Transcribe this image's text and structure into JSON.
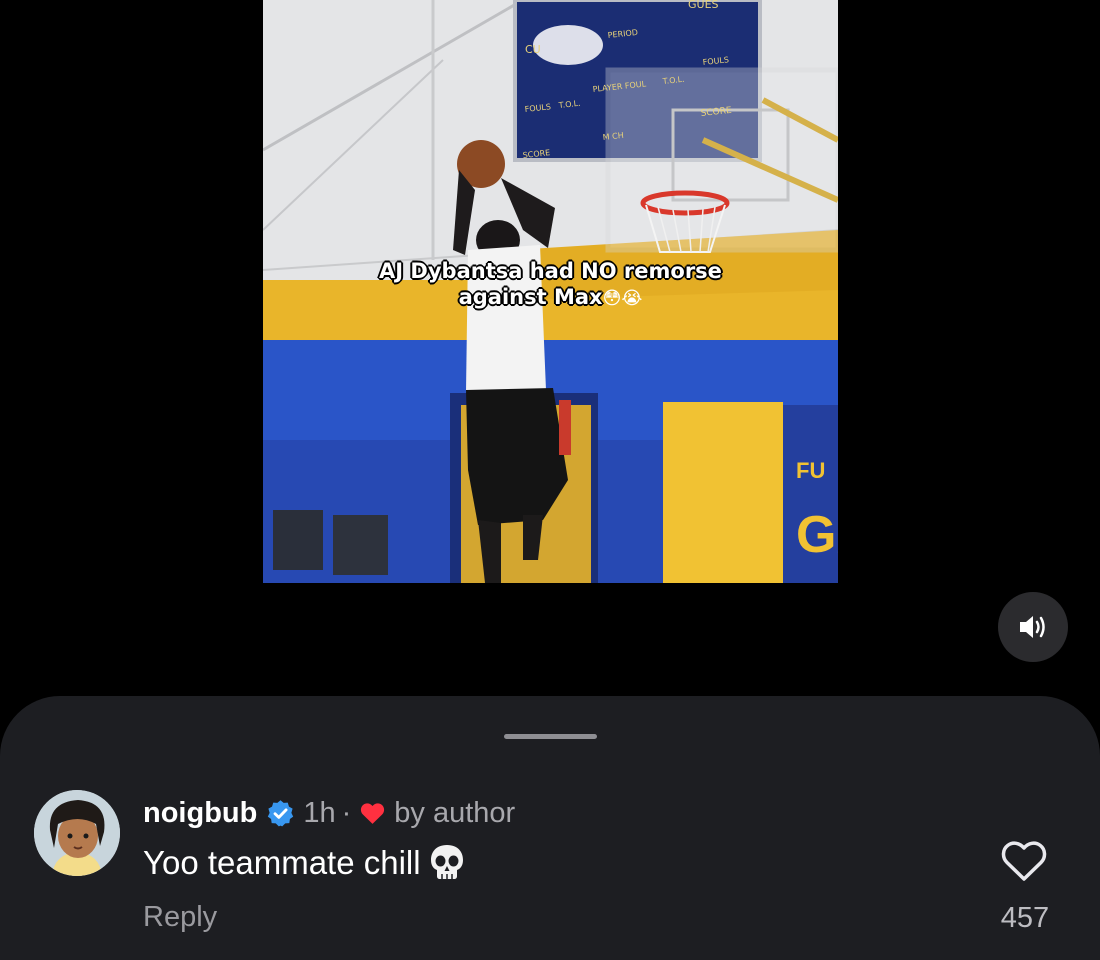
{
  "video": {
    "caption_line1": "AJ Dybantsa had NO remorse",
    "caption_line2": "against Max",
    "caption_emojis": "😳😭",
    "scoreboard": {
      "period": "PERIOD",
      "fouls_left": "FOULS",
      "tol_left": "T.O.L.",
      "player_foul": "PLAYER FOUL",
      "tol_right": "T.O.L.",
      "fouls_right": "FOULS",
      "score_left": "SCORE",
      "score_right": "SCORE",
      "match": "M CH",
      "guest": "GUES",
      "cu": "CU"
    },
    "banner_left": "FU",
    "banner_right": "GA"
  },
  "controls": {
    "sound_icon": "speaker-on-icon"
  },
  "comment": {
    "username": "noigbub",
    "verified": true,
    "time": "1h",
    "separator": "·",
    "author_like_label": "by author",
    "text": "Yoo teammate chill",
    "emoji": "skull",
    "reply_label": "Reply",
    "like_count": "457"
  },
  "colors": {
    "sheet_background": "#1d1e22",
    "verified_blue": "#3897f0",
    "heart_red": "#ff3040",
    "muted_text": "#a8a8ad"
  }
}
